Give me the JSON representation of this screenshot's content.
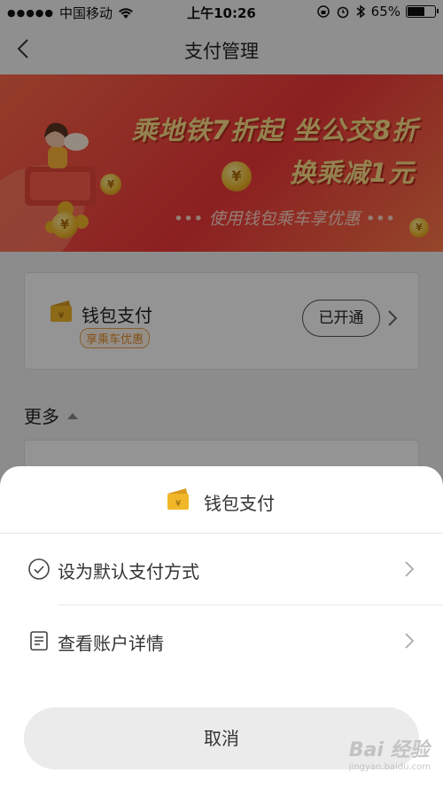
{
  "status_bar": {
    "carrier": "中国移动",
    "time": "上午10:26",
    "battery": "65%",
    "battery_level": 0.65
  },
  "nav": {
    "title": "支付管理"
  },
  "banner": {
    "line1": "乘地铁7折起 坐公交8折",
    "line2": "换乘减1元",
    "line3": "••• 使用钱包乘车享优惠 •••"
  },
  "wallet_card": {
    "label": "钱包支付",
    "tag": "享乘车优惠",
    "status": "已开通"
  },
  "more": {
    "label": "更多"
  },
  "sheet": {
    "title": "钱包支付",
    "options": [
      {
        "label": "设为默认支付方式",
        "icon": "check-circle-icon"
      },
      {
        "label": "查看账户详情",
        "icon": "document-icon"
      }
    ],
    "cancel": "取消"
  },
  "watermark": {
    "text": "Bai 经验",
    "sub": "jingyan.baidu.com"
  },
  "colors": {
    "banner_red": "#f0373a",
    "banner_text": "#ffe28a",
    "tag_orange": "#e48a2a",
    "wallet_gold": "#f1b729"
  }
}
